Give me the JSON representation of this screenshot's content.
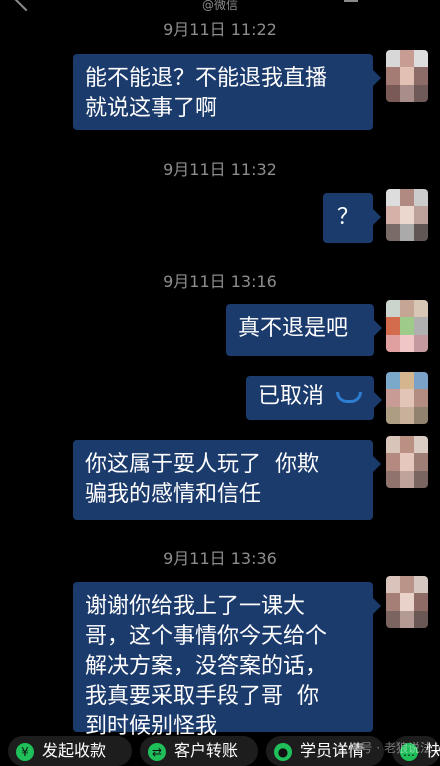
{
  "top": {
    "source": "@微信"
  },
  "messages": [
    {
      "time": "9月11日 11:22",
      "text": "能不能退？不能退我直播\n就说这事了啊"
    },
    {
      "time": "9月11日 11:32",
      "text": "？"
    },
    {
      "time": "9月11日 13:16",
      "text": "真不退是吧"
    },
    {
      "time": "",
      "text": "已取消",
      "icon": "phone-hangup-icon"
    },
    {
      "time": "",
      "text": "你这属于耍人玩了  你欺\n骗我的感情和信任"
    },
    {
      "time": "9月11日 13:36",
      "text": "谢谢你给我上了一课大\n哥，这个事情你今天给个\n解决方案，没答案的话，\n我真要采取手段了哥  你\n到时候别怪我"
    }
  ],
  "bottom_actions": [
    {
      "label": "发起收款",
      "icon": "yen-icon"
    },
    {
      "label": "客户转账",
      "icon": "transfer-icon"
    },
    {
      "label": "学员详情",
      "icon": "profile-icon"
    },
    {
      "label": "快",
      "icon": "more-icon"
    }
  ],
  "watermark": "公众号 · 老狼说法"
}
